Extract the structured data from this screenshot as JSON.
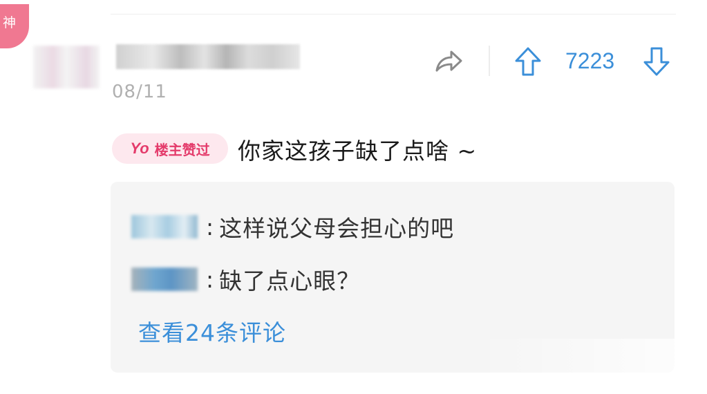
{
  "post": {
    "badge_god": "神",
    "date": "08/11",
    "vote_count": "7223",
    "op_badge": {
      "yo": "Yo",
      "label": "楼主赞过"
    },
    "comment": "你家这孩子缺了点啥 ~"
  },
  "replies": [
    {
      "text": "这样说父母会担心的吧"
    },
    {
      "text": "缺了点心眼？"
    }
  ],
  "view_comments": "查看24条评论",
  "colors": {
    "accent": "#3b8fd9",
    "badge_pink": "#f07891",
    "op_badge_text": "#e43b6b"
  },
  "icons": [
    "share-icon",
    "upvote-arrow-icon",
    "downvote-arrow-icon"
  ]
}
